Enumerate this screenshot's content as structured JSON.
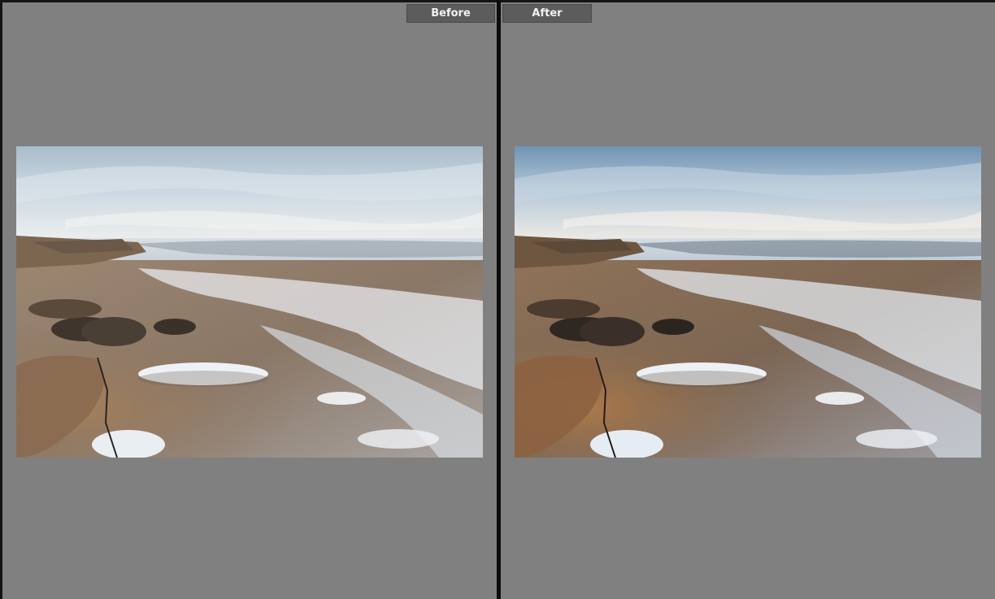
{
  "panes": {
    "before": {
      "label": "Before"
    },
    "after": {
      "label": "After"
    }
  },
  "photo": {
    "subject": "rocky-shoreline-with-tide-pools"
  },
  "colors": {
    "pane_background": "#808080",
    "divider": "#0c0c0c",
    "label_background": "#5c5c5c",
    "label_text": "#f2f2f2"
  }
}
